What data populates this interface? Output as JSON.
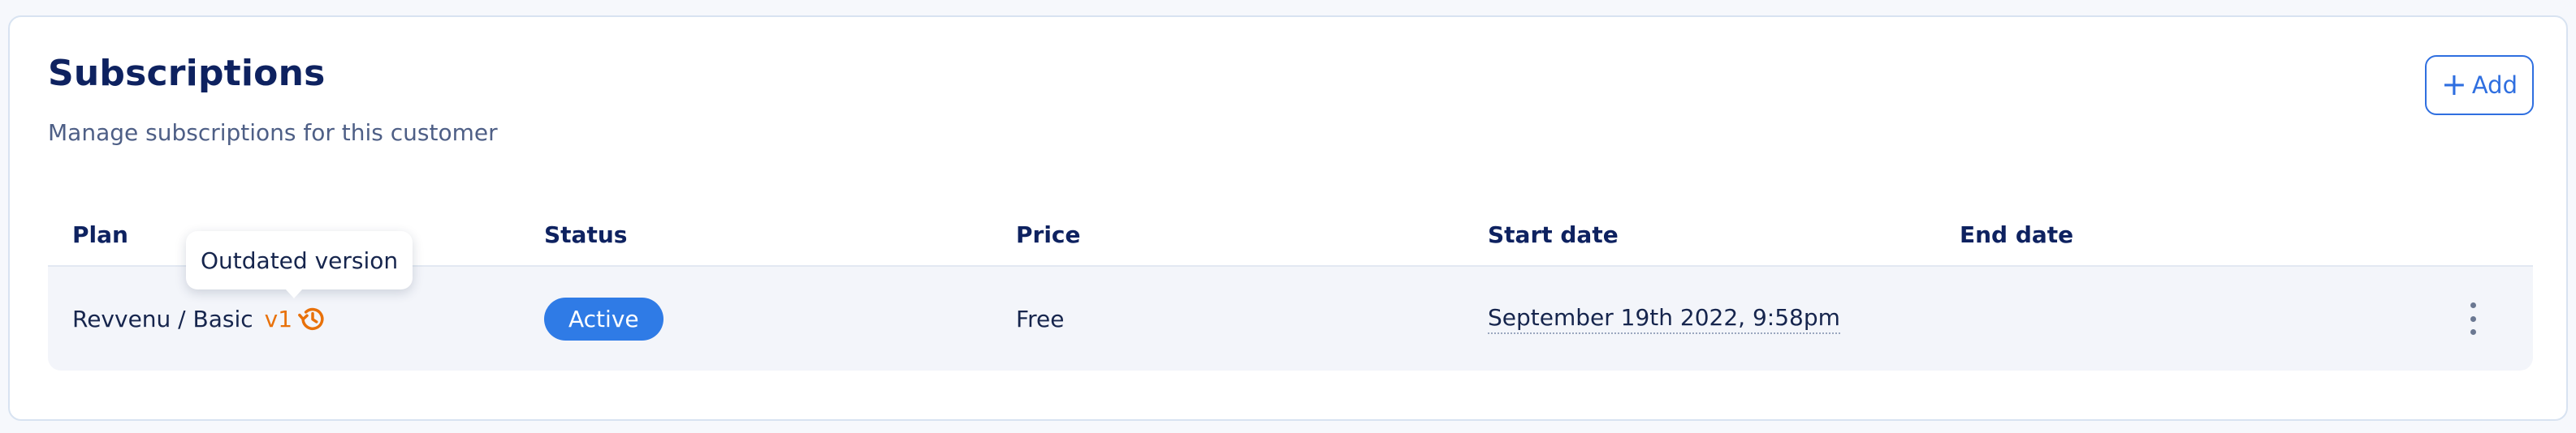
{
  "header": {
    "title": "Subscriptions",
    "subtitle": "Manage subscriptions for this customer",
    "add_label": "Add",
    "add_icon": "plus-icon"
  },
  "table": {
    "columns": [
      "Plan",
      "Status",
      "Price",
      "Start date",
      "End date"
    ],
    "rows": [
      {
        "plan": "Revvenu / Basic",
        "version": "v1",
        "version_icon": "history-icon",
        "status": "Active",
        "price": "Free",
        "start_date": "September 19th 2022, 9:58pm",
        "end_date": "",
        "actions_icon": "more-vertical-icon"
      }
    ]
  },
  "tooltip": {
    "text": "Outdated version"
  },
  "colors": {
    "title": "#0e2260",
    "accent": "#2f6fe0",
    "status_active": "#2f7be6",
    "version_warning": "#e8710a",
    "row_background": "#f3f5fa"
  }
}
